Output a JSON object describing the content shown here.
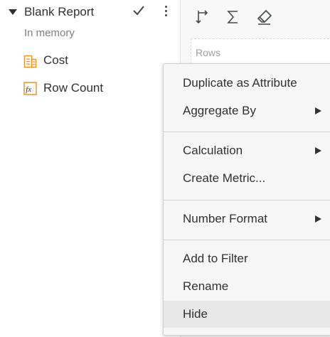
{
  "dataset": {
    "title": "Blank Report",
    "subtitle": "In memory",
    "objects": [
      {
        "label": "Cost",
        "icon": "metric-icon"
      },
      {
        "label": "Row Count",
        "icon": "fx-icon"
      }
    ]
  },
  "editor": {
    "rows_placeholder": "Rows"
  },
  "context_menu": {
    "items": [
      {
        "label": "Duplicate as Attribute",
        "has_submenu": false
      },
      {
        "label": "Aggregate By",
        "has_submenu": true
      },
      {
        "label": "Calculation",
        "has_submenu": true
      },
      {
        "label": "Create Metric...",
        "has_submenu": false
      },
      {
        "label": "Number Format",
        "has_submenu": true
      },
      {
        "label": "Add to Filter",
        "has_submenu": false
      },
      {
        "label": "Rename",
        "has_submenu": false
      },
      {
        "label": "Hide",
        "has_submenu": false,
        "hovered": true
      }
    ]
  },
  "colors": {
    "metric_icon": "#e8952a",
    "menu_background": "#f7f7f7",
    "menu_hover": "#e8e8e8",
    "text": "#2f3133"
  }
}
